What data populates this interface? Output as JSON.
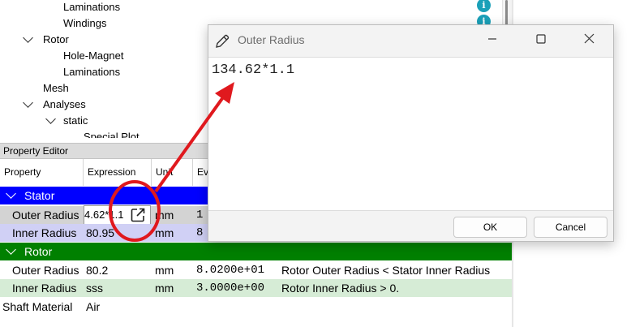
{
  "tree": {
    "items": [
      {
        "label": "Laminations"
      },
      {
        "label": "Windings"
      },
      {
        "label": "Rotor"
      },
      {
        "label": "Hole-Magnet"
      },
      {
        "label": "Laminations"
      },
      {
        "label": "Mesh"
      },
      {
        "label": "Analyses"
      },
      {
        "label": "static"
      },
      {
        "label": "Special Plot"
      }
    ]
  },
  "property_editor": {
    "title": "Property Editor",
    "columns": [
      "Property",
      "Expression",
      "Unit",
      "Ev"
    ],
    "sections": [
      {
        "label": "Stator",
        "color": "#0000ff",
        "rows": [
          {
            "property": "Outer Radius",
            "expression": "4.62*1.1",
            "unit": "mm",
            "evaluated": "1"
          },
          {
            "property": "Inner Radius",
            "expression": "80.95",
            "unit": "mm",
            "evaluated": "8"
          }
        ]
      },
      {
        "label": "Rotor",
        "color": "#008000",
        "rows": [
          {
            "property": "Outer Radius",
            "expression": "80.2",
            "unit": "mm",
            "evaluated": "8.0200e+01",
            "message": "Rotor Outer Radius < Stator Inner Radius"
          },
          {
            "property": "Inner Radius",
            "expression": "sss",
            "unit": "mm",
            "evaluated": "3.0000e+00",
            "message": "Rotor Inner Radius > 0."
          }
        ]
      }
    ],
    "shaft": {
      "property": "Shaft Material",
      "expression": "Air"
    }
  },
  "dialog": {
    "title": "Outer Radius",
    "content": "134.62*1.1",
    "ok_label": "OK",
    "cancel_label": "Cancel"
  },
  "icons": {
    "title_icon": "pencil-icon",
    "info": "info-icon",
    "expand": "external-open-icon"
  },
  "colors": {
    "annotation_red": "#e0191e",
    "stator_row_bg": "#d3d3d3",
    "stator_row2_bg": "#d0d0f5",
    "rotor_row2_bg": "#d6ecd6"
  }
}
